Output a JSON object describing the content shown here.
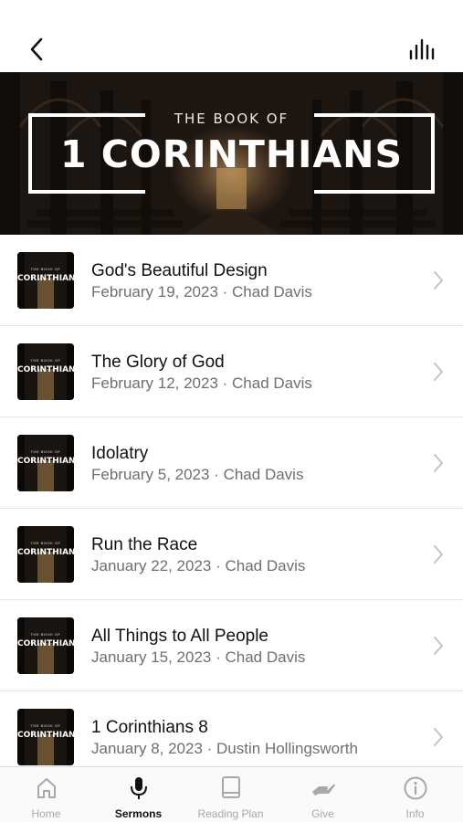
{
  "header": {
    "back_icon": "chevron-left-icon",
    "audio_icon": "audio-bars-icon"
  },
  "banner": {
    "kicker": "THE BOOK OF",
    "title": "1 CORINTHIANS"
  },
  "thumbnail": {
    "kicker": "THE BOOK OF",
    "title": "CORINTHIANS"
  },
  "sermons": [
    {
      "title": "God's Beautiful Design",
      "subtitle": "February 19, 2023 · Chad Davis"
    },
    {
      "title": "The Glory of God",
      "subtitle": "February 12, 2023 · Chad Davis"
    },
    {
      "title": "Idolatry",
      "subtitle": "February 5, 2023 · Chad Davis"
    },
    {
      "title": "Run the Race",
      "subtitle": "January 22, 2023 · Chad Davis"
    },
    {
      "title": "All Things to All People",
      "subtitle": "January 15, 2023 · Chad Davis"
    },
    {
      "title": "1 Corinthians 8",
      "subtitle": "January 8, 2023 · Dustin Hollingsworth"
    }
  ],
  "tabs": [
    {
      "label": "Home",
      "icon": "home-icon",
      "active": false
    },
    {
      "label": "Sermons",
      "icon": "microphone-icon",
      "active": true
    },
    {
      "label": "Reading Plan",
      "icon": "book-icon",
      "active": false
    },
    {
      "label": "Give",
      "icon": "give-hand-icon",
      "active": false
    },
    {
      "label": "Info",
      "icon": "info-icon",
      "active": false
    }
  ],
  "colors": {
    "active_tab": "#111111",
    "inactive_tab": "#a8a8a8",
    "subtitle": "#6f6f6f",
    "divider": "#e6e6e6"
  }
}
